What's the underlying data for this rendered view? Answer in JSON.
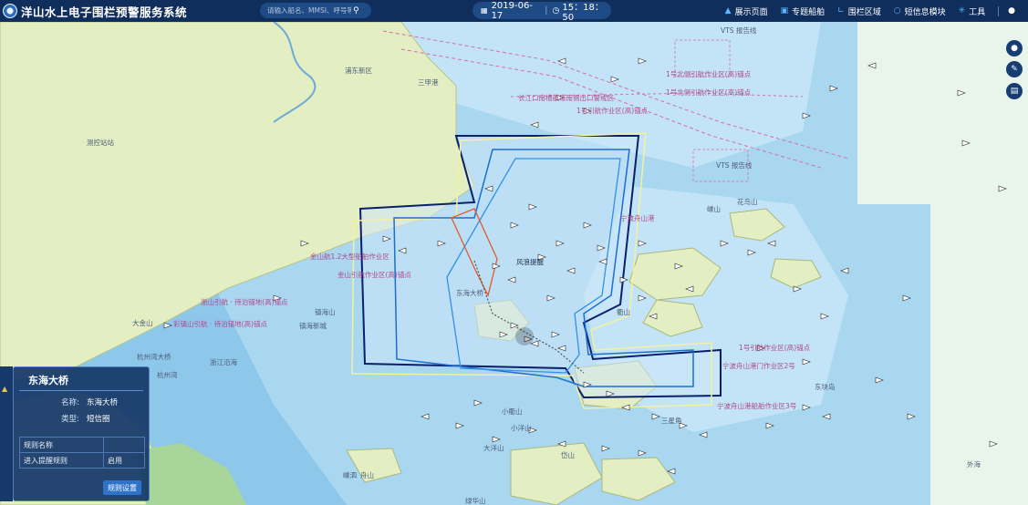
{
  "header": {
    "title": "洋山水上电子围栏预警服务系统",
    "search_placeholder": "请输入船名、MMSI、呼号等",
    "date": "2019-06-17",
    "time": "15：18：50",
    "nav": [
      {
        "label": "展示页面",
        "icon": "home-icon"
      },
      {
        "label": "专题船舶",
        "icon": "ship-icon"
      },
      {
        "label": "围栏区域",
        "icon": "fence-icon"
      },
      {
        "label": "短信息模块",
        "icon": "message-icon"
      },
      {
        "label": "工具",
        "icon": "gear-icon"
      }
    ]
  },
  "map": {
    "labels": {
      "pudong": "浦东新区",
      "sanjia": "三甲港",
      "station": "测控站站",
      "vts_north": "VTS 报告线",
      "vts_mid": "VTS 报告线",
      "anchor1": "1号北侧引航作业区(高)锚点",
      "anchor2": "1号北侧引航作业区(高)锚点",
      "anchor3": "1号引航作业区(高)锚点",
      "channel": "长江口南槽航道南侧出口警戒区",
      "jinshan1": "金山航1.2大型船舶作业区",
      "jinshan2": "金山引航作业区(高)锚点",
      "fengtai": "风浪提醒",
      "dongyu": "东海大桥",
      "zhaowan": "浙江沿海",
      "ningbo": "宁波舟山港",
      "ningbo2": "宁波舟山港船舶作业区3号",
      "ptzone": "宁波舟山港门作业区2号",
      "yiyin": "1号引航作业区(高)锚点",
      "zhenhai": "镇海山",
      "zhejiang1": "浙山引航 · 待泊锚地(高)锚点",
      "zhejiang2": "彩镇山引航 · 待泊锚地(高)锚点",
      "hangzhouwan": "杭州湾大桥",
      "hangzhou": "杭州湾",
      "dajin": "大金山",
      "shengsi": "嵊泗",
      "daxie": "小衢山",
      "yang": "小洋山",
      "yang2": "大洋山",
      "huan": "花鸟山",
      "sheshan": "嵊山",
      "qushan": "衢山",
      "daishan": "岱山",
      "dongluo": "东块岛",
      "lv": "绿华山",
      "ocean": "外海",
      "x1": "镇海新城",
      "x2": "舟山",
      "x3": "三星角"
    }
  },
  "panel": {
    "title": "东海大桥",
    "name_key": "名称:",
    "name_val": "东海大桥",
    "type_key": "类型:",
    "type_val": "短信圈",
    "table_header": "规则名称",
    "rule_name": "进入提醒规则",
    "rule_status": "启用",
    "button": "规则设置"
  }
}
